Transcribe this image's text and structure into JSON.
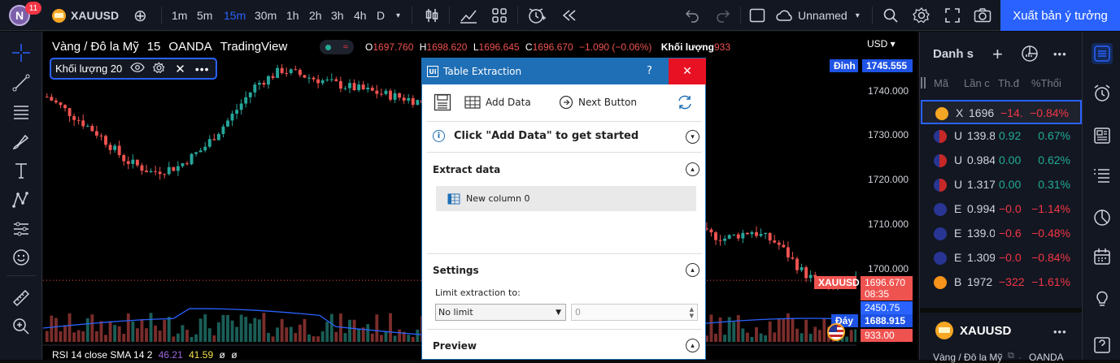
{
  "topbar": {
    "avatar_letter": "N",
    "notif_count": "11",
    "symbol": "XAUUSD",
    "intervals": [
      "1m",
      "5m",
      "15m",
      "30m",
      "1h",
      "2h",
      "3h",
      "4h",
      "D"
    ],
    "active_interval": "15m",
    "layout_name": "Unnamed",
    "publish_label": "Xuất bản ý tưởng"
  },
  "chart": {
    "title": "Vàng / Đô la Mỹ · 15 · OANDA · TradingView",
    "title_parts": [
      "Vàng / Đô la Mỹ",
      "15",
      "OANDA",
      "TradingView"
    ],
    "ohlc": {
      "o_label": "O",
      "o": "1697.760",
      "h_label": "H",
      "h": "1698.620",
      "l_label": "L",
      "l": "1696.645",
      "c_label": "C",
      "c": "1696.670",
      "change": "−1.090 (−0.06%)"
    },
    "volume_label": "Khối lượng",
    "volume_value": "933",
    "indicator_label": "Khối lượng 20",
    "rsi_label": "RSI 14 close SMA 14 2",
    "rsi_v1": "46.21",
    "rsi_v2": "41.59",
    "rsi_v3": "ø",
    "rsi_v4": "ø",
    "currency": "USD",
    "high_tag": "Đỉnh",
    "high_value": "1745.555",
    "low_tag": "Đáy",
    "low_value": "1688.915",
    "price_tag": "XAUUSD",
    "price_value": "1696.670",
    "countdown": "08:35",
    "ma_value": "2450.75",
    "vol_tag": "933.00",
    "yticks": [
      "1740.000",
      "1730.000",
      "1720.000",
      "1710.000",
      "1700.000"
    ]
  },
  "chart_data": {
    "type": "candlestick",
    "title": "Vàng / Đô la Mỹ",
    "ylabel": "USD",
    "ylim": [
      1688,
      1747
    ],
    "y_ticks": [
      1700,
      1710,
      1720,
      1730,
      1740
    ],
    "series": [
      {
        "name": "XAUUSD",
        "values": [
          1738.5,
          1734.2,
          1729.8,
          1724.0,
          1721.3,
          1722.5,
          1726.8,
          1733.5,
          1741.2,
          1744.6,
          1743.0,
          1741.5,
          1740.2,
          1739.0,
          1737.8,
          1736.2,
          1735.1,
          1733.0,
          1736.5,
          1734.8,
          1732.1,
          1728.4,
          1722.0,
          1712.5,
          1708.4,
          1707.6,
          1706.2,
          1707.9,
          1705.1,
          1698.3,
          1694.5,
          1696.67
        ]
      }
    ],
    "colors": {
      "up": "#26a69a",
      "down": "#ef5350"
    }
  },
  "dialog": {
    "title": "Table Extraction",
    "help": "?",
    "close": "✕",
    "add_data": "Add Data",
    "next_button": "Next Button",
    "info_text": "Click \"Add Data\" to get started",
    "extract_title": "Extract data",
    "column_name": "New column 0",
    "settings_title": "Settings",
    "limit_label": "Limit extraction to:",
    "limit_value": "No limit",
    "limit_number": "0",
    "preview_title": "Preview"
  },
  "watchlist": {
    "title": "Danh s",
    "headers": [
      "Mã",
      "Lần c",
      "Th.đ",
      "%Thổi"
    ],
    "rows": [
      {
        "sym": "X",
        "last": "1696",
        "chg": "−14.",
        "pct": "−0.84%",
        "color": "#f23645",
        "flag": "gold"
      },
      {
        "sym": "U",
        "last": "139.8",
        "chg": "0.92",
        "pct": "0.67%",
        "color": "#22ab94",
        "flag": "us"
      },
      {
        "sym": "U",
        "last": "0.984",
        "chg": "0.00",
        "pct": "0.62%",
        "color": "#22ab94",
        "flag": "us"
      },
      {
        "sym": "U",
        "last": "1.317",
        "chg": "0.00",
        "pct": "0.31%",
        "color": "#22ab94",
        "flag": "us"
      },
      {
        "sym": "E",
        "last": "0.994",
        "chg": "−0.0",
        "pct": "−1.14%",
        "color": "#f23645",
        "flag": "eu"
      },
      {
        "sym": "E",
        "last": "139.0",
        "chg": "−0.6",
        "pct": "−0.48%",
        "color": "#f23645",
        "flag": "eu"
      },
      {
        "sym": "E",
        "last": "1.309",
        "chg": "−0.0",
        "pct": "−0.84%",
        "color": "#f23645",
        "flag": "eu"
      },
      {
        "sym": "B",
        "last": "1972",
        "chg": "−322",
        "pct": "−1.61%",
        "color": "#f23645",
        "flag": "btc"
      }
    ],
    "detail_symbol": "XAUUSD",
    "detail_desc": "Vàng / Đô la Mỹ",
    "detail_exchange": "OANDA"
  },
  "colors": {
    "accent": "#2962ff",
    "up": "#26a69a",
    "down": "#ef5350",
    "dialog": "#1f6fb6"
  }
}
